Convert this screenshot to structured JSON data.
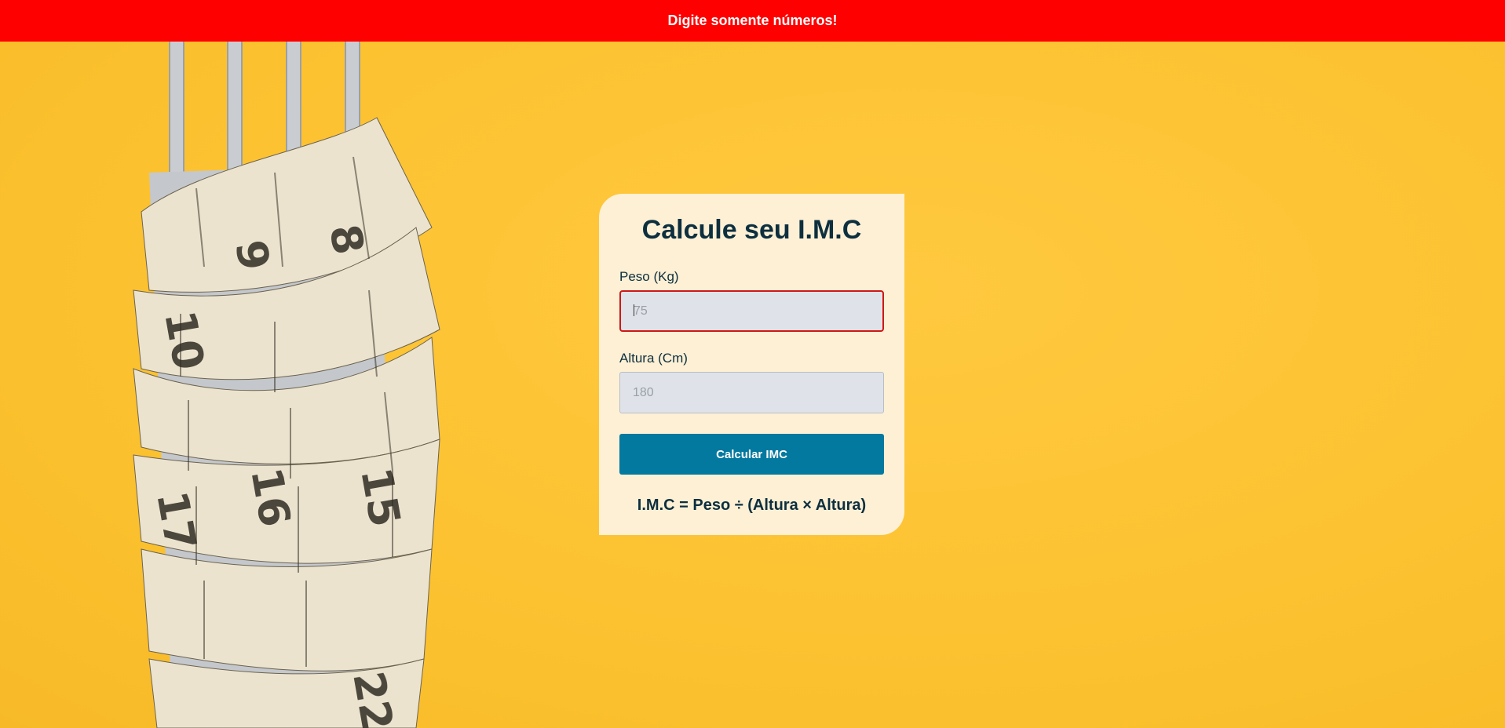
{
  "alert": {
    "message": "Digite somente números!",
    "color": "#ff0000"
  },
  "background": {
    "color": "#fbc02d",
    "image_icon": "fork-measuring-tape-icon"
  },
  "card": {
    "title": "Calcule seu I.M.C",
    "peso": {
      "label": "Peso (Kg)",
      "placeholder": "75",
      "value": "",
      "state": "error"
    },
    "altura": {
      "label": "Altura (Cm)",
      "placeholder": "180",
      "value": ""
    },
    "button_label": "Calcular IMC",
    "button_color": "#04799f",
    "formula": "I.M.C = Peso ÷ (Altura × Altura)"
  }
}
